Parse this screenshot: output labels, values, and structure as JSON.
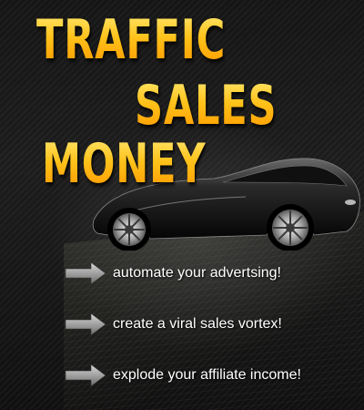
{
  "headline": {
    "line1": "TRAFFIC",
    "line2": "SALES",
    "line3": "MONEY"
  },
  "bullets": [
    {
      "text": "automate your advertsing!"
    },
    {
      "text": "create a viral sales vortex!"
    },
    {
      "text": "explode your affiliate income!"
    }
  ],
  "colors": {
    "headline": "#ffb400",
    "bullet_text": "#ffffff",
    "arrow": "#9a9a9a",
    "background": "#151515"
  },
  "icons": {
    "car": "sports-car-icon",
    "arrow": "right-arrow-icon"
  }
}
